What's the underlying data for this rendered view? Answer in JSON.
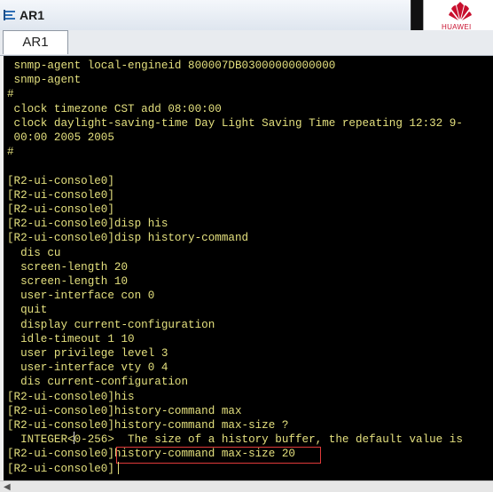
{
  "window": {
    "title": "AR1",
    "tab_label": "AR1",
    "logo_text": "HUAWEI"
  },
  "terminal": {
    "lines": [
      " snmp-agent local-engineid 800007DB03000000000000",
      " snmp-agent",
      "#",
      " clock timezone CST add 08:00:00",
      " clock daylight-saving-time Day Light Saving Time repeating 12:32 9-",
      " 00:00 2005 2005",
      "#",
      "",
      "[R2-ui-console0]",
      "[R2-ui-console0]",
      "[R2-ui-console0]",
      "[R2-ui-console0]disp his",
      "[R2-ui-console0]disp history-command",
      "  dis cu",
      "  screen-length 20",
      "  screen-length 10",
      "  user-interface con 0",
      "  quit",
      "  display current-configuration",
      "  idle-timeout 1 10",
      "  user privilege level 3",
      "  user-interface vty 0 4",
      "  dis current-configuration",
      "[R2-ui-console0]his",
      "[R2-ui-console0]history-command max",
      "[R2-ui-console0]history-command max-size ?",
      "  INTEGER<0-256>  The size of a history buffer, the default value is",
      "[R2-ui-console0]history-command max-size 20",
      "[R2-ui-console0]"
    ]
  },
  "colors": {
    "terminal_bg": "#000000",
    "terminal_text": "#e4e07e",
    "highlight_box": "#e03a3a"
  }
}
